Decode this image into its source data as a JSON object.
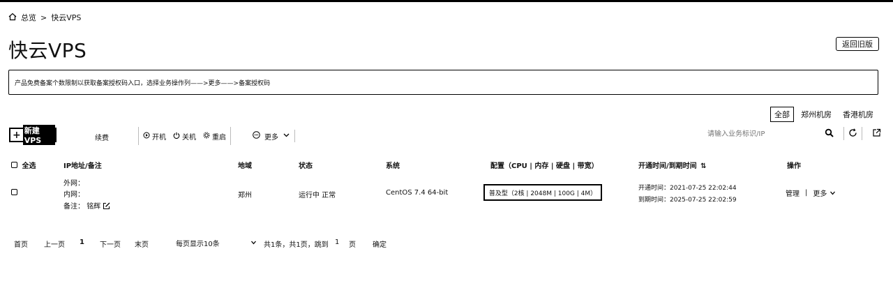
{
  "breadcrumb": {
    "home": "总览",
    "separator": ">",
    "current": "快云VPS"
  },
  "page_title": "快云VPS",
  "back_button": "返回旧版",
  "notice": "产品免费备案个数限制以获取备案授权码入口，选择业务操作列——>更多——>备案授权码",
  "region_tabs": [
    "全部",
    "郑州机房",
    "香港机房"
  ],
  "toolbar": {
    "new_vps": "新建VPS",
    "new_vps_plus": "+",
    "renew": "续费",
    "start": "开机",
    "shutdown": "关机",
    "restart": "重启",
    "more": "更多",
    "search_placeholder": "请输入业务标识/IP"
  },
  "table": {
    "headers": {
      "select_all": "全选",
      "ip": "IP地址/备注",
      "region": "地域",
      "status": "状态",
      "system": "系统",
      "config": "配置（CPU | 内存 | 硬盘 | 带宽）",
      "time": "开通时间/到期时间",
      "actions": "操作"
    },
    "rows": [
      {
        "public_ip": "外网：",
        "private_ip": "内网：",
        "remark_label": "备注：",
        "remark": "铭辉",
        "region": "郑州",
        "status": "运行中 正常",
        "system": "CentOS 7.4 64-bit",
        "config": "普及型（2核 | 2048M | 100G | 4M）",
        "open_time": "开通时间：2021-07-25 22:02:44",
        "expire_time": "到期时间：2025-07-25 22:02:59",
        "manage": "管理",
        "divider": "|",
        "more": "更多"
      }
    ]
  },
  "pager": {
    "first": "首页",
    "prev": "上一页",
    "page": "1",
    "next": "下一页",
    "last": "末页",
    "per_page": "每页显示10条",
    "summary": "共1条，共1页，跳到",
    "jump_value": "1",
    "page_unit": "页",
    "confirm": "确定"
  }
}
